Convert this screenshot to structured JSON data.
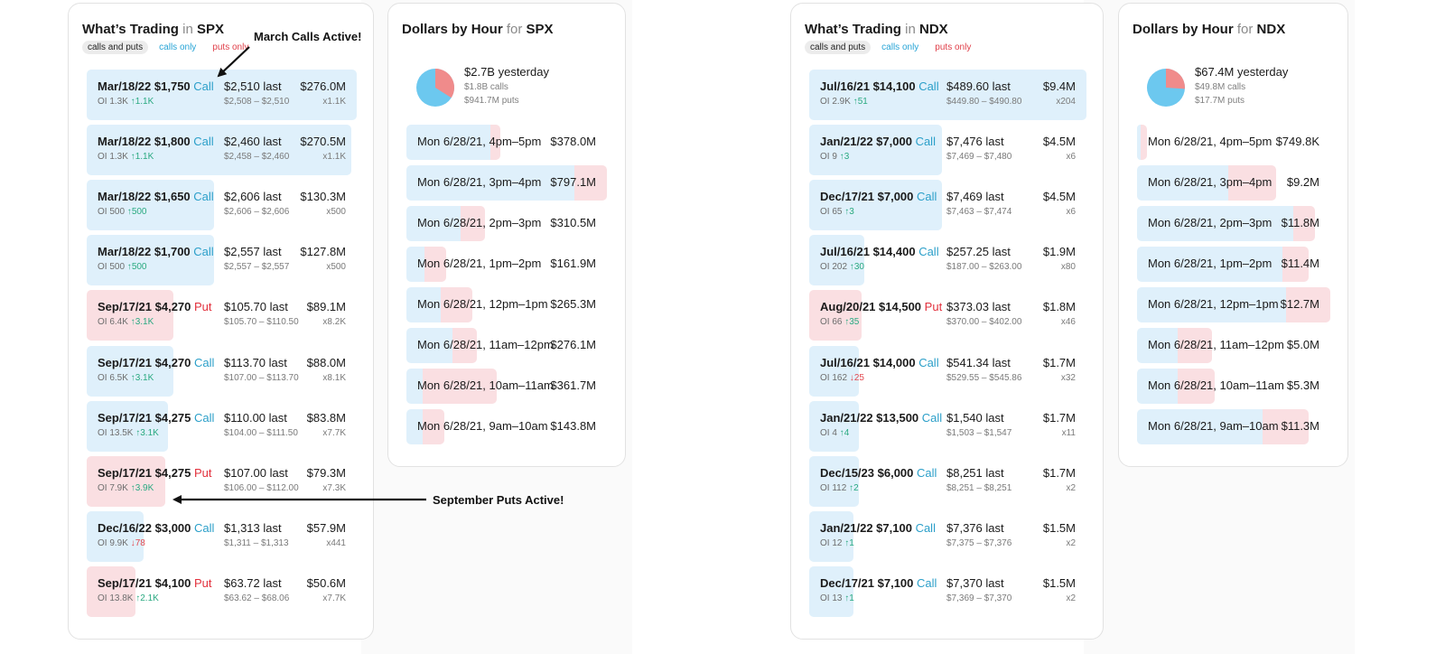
{
  "panels": [
    {
      "title": {
        "prefix": "What’s Trading",
        "joiner": "in",
        "symbol": "SPX"
      },
      "filters": {
        "all": "calls and puts",
        "calls": "calls only",
        "puts": "puts only"
      },
      "rows": [
        {
          "date": "Mar/18/22",
          "strike": "$1,750",
          "type": "Call",
          "oi": "OI 1.3K",
          "change": "1.1K",
          "dir": "up",
          "last": "$2,510",
          "range": "$2,508 – $2,510",
          "premium": "$276.0M",
          "mult": "x1.1K",
          "share": 1.0,
          "oi_share": 0.24
        },
        {
          "date": "Mar/18/22",
          "strike": "$1,800",
          "type": "Call",
          "oi": "OI 1.3K",
          "change": "1.1K",
          "dir": "up",
          "last": "$2,460",
          "range": "$2,458 – $2,460",
          "premium": "$270.5M",
          "mult": "x1.1K",
          "share": 0.98,
          "oi_share": 0.24
        },
        {
          "date": "Mar/18/22",
          "strike": "$1,650",
          "type": "Call",
          "oi": "OI 500",
          "change": "500",
          "dir": "up",
          "last": "$2,606",
          "range": "$2,606 – $2,606",
          "premium": "$130.3M",
          "mult": "x500",
          "share": 0.47,
          "oi_share": 0.18
        },
        {
          "date": "Mar/18/22",
          "strike": "$1,700",
          "type": "Call",
          "oi": "OI 500",
          "change": "500",
          "dir": "up",
          "last": "$2,557",
          "range": "$2,557 – $2,557",
          "premium": "$127.8M",
          "mult": "x500",
          "share": 0.47,
          "oi_share": 0.18
        },
        {
          "date": "Sep/17/21",
          "strike": "$4,270",
          "type": "Put",
          "oi": "OI 6.4K",
          "change": "3.1K",
          "dir": "up",
          "last": "$105.70 last",
          "range": "$105.70 – $110.50",
          "premium": "$89.1M",
          "mult": "x8.2K",
          "share": 0.32,
          "oi_share": 0.2
        },
        {
          "date": "Sep/17/21",
          "strike": "$4,270",
          "type": "Call",
          "oi": "OI 6.5K",
          "change": "3.1K",
          "dir": "up",
          "last": "$113.70 last",
          "range": "$107.00 – $113.70",
          "premium": "$88.0M",
          "mult": "x8.1K",
          "share": 0.32,
          "oi_share": 0.2
        },
        {
          "date": "Sep/17/21",
          "strike": "$4,275",
          "type": "Call",
          "oi": "OI 13.5K",
          "change": "3.1K",
          "dir": "up",
          "last": "$110.00 last",
          "range": "$104.00 – $111.50",
          "premium": "$83.8M",
          "mult": "x7.7K",
          "share": 0.3,
          "oi_share": 0.2
        },
        {
          "date": "Sep/17/21",
          "strike": "$4,275",
          "type": "Put",
          "oi": "OI 7.9K",
          "change": "3.9K",
          "dir": "up",
          "last": "$107.00 last",
          "range": "$106.00 – $112.00",
          "premium": "$79.3M",
          "mult": "x7.3K",
          "share": 0.29,
          "oi_share": 0.2
        },
        {
          "date": "Dec/16/22",
          "strike": "$3,000",
          "type": "Call",
          "oi": "OI 9.9K",
          "change": "78",
          "dir": "down",
          "last": "$1,313 last",
          "range": "$1,311 – $1,313",
          "premium": "$57.9M",
          "mult": "x441",
          "share": 0.21,
          "oi_share": 0.18
        },
        {
          "date": "Sep/17/21",
          "strike": "$4,100",
          "type": "Put",
          "oi": "OI 13.8K",
          "change": "2.1K",
          "dir": "up",
          "last": "$63.72 last",
          "range": "$63.62 – $68.06",
          "premium": "$50.6M",
          "mult": "x7.7K",
          "share": 0.18,
          "oi_share": 0.18
        }
      ]
    },
    {
      "title": {
        "prefix": "What’s Trading",
        "joiner": "in",
        "symbol": "NDX"
      },
      "filters": {
        "all": "calls and puts",
        "calls": "calls only",
        "puts": "puts only"
      },
      "rows": [
        {
          "date": "Jul/16/21",
          "strike": "$14,100",
          "type": "Call",
          "oi": "OI 2.9K",
          "change": "51",
          "dir": "up",
          "last": "$489.60 last",
          "range": "$449.80 – $490.80",
          "premium": "$9.4M",
          "mult": "x204",
          "share": 1.0,
          "oi_share": 0.16
        },
        {
          "date": "Jan/21/22",
          "strike": "$7,000",
          "type": "Call",
          "oi": "OI 9",
          "change": "3",
          "dir": "up",
          "last": "$7,476 last",
          "range": "$7,469 – $7,480",
          "premium": "$4.5M",
          "mult": "x6",
          "share": 0.48,
          "oi_share": 0.16
        },
        {
          "date": "Dec/17/21",
          "strike": "$7,000",
          "type": "Call",
          "oi": "OI 65",
          "change": "3",
          "dir": "up",
          "last": "$7,469 last",
          "range": "$7,463 – $7,474",
          "premium": "$4.5M",
          "mult": "x6",
          "share": 0.48,
          "oi_share": 0.16
        },
        {
          "date": "Jul/16/21",
          "strike": "$14,400",
          "type": "Call",
          "oi": "OI 202",
          "change": "30",
          "dir": "up",
          "last": "$257.25 last",
          "range": "$187.00 – $263.00",
          "premium": "$1.9M",
          "mult": "x80",
          "share": 0.2,
          "oi_share": 0.16
        },
        {
          "date": "Aug/20/21",
          "strike": "$14,500",
          "type": "Put",
          "oi": "OI 66",
          "change": "35",
          "dir": "up",
          "last": "$373.03 last",
          "range": "$370.00 – $402.00",
          "premium": "$1.8M",
          "mult": "x46",
          "share": 0.19,
          "oi_share": 0.16
        },
        {
          "date": "Jul/16/21",
          "strike": "$14,000",
          "type": "Call",
          "oi": "OI 162",
          "change": "25",
          "dir": "down",
          "last": "$541.34 last",
          "range": "$529.55 – $545.86",
          "premium": "$1.7M",
          "mult": "x32",
          "share": 0.18,
          "oi_share": 0.16
        },
        {
          "date": "Jan/21/22",
          "strike": "$13,500",
          "type": "Call",
          "oi": "OI 4",
          "change": "4",
          "dir": "up",
          "last": "$1,540 last",
          "range": "$1,503 – $1,547",
          "premium": "$1.7M",
          "mult": "x11",
          "share": 0.18,
          "oi_share": 0.16
        },
        {
          "date": "Dec/15/23",
          "strike": "$6,000",
          "type": "Call",
          "oi": "OI 112",
          "change": "2",
          "dir": "up",
          "last": "$8,251 last",
          "range": "$8,251 – $8,251",
          "premium": "$1.7M",
          "mult": "x2",
          "share": 0.18,
          "oi_share": 0.16
        },
        {
          "date": "Jan/21/22",
          "strike": "$7,100",
          "type": "Call",
          "oi": "OI 12",
          "change": "1",
          "dir": "up",
          "last": "$7,376 last",
          "range": "$7,375 – $7,376",
          "premium": "$1.5M",
          "mult": "x2",
          "share": 0.16,
          "oi_share": 0.16
        },
        {
          "date": "Dec/17/21",
          "strike": "$7,100",
          "type": "Call",
          "oi": "OI 13",
          "change": "1",
          "dir": "up",
          "last": "$7,370 last",
          "range": "$7,369 – $7,370",
          "premium": "$1.5M",
          "mult": "x2",
          "share": 0.16,
          "oi_share": 0.16
        }
      ]
    }
  ],
  "hourly": [
    {
      "title": {
        "prefix": "Dollars by Hour",
        "joiner": "for",
        "symbol": "SPX"
      },
      "summary": {
        "total": "$2.7B yesterday",
        "calls": "$1.8B calls",
        "puts": "$941.7M puts"
      },
      "pie": {
        "calls_fraction": 0.66
      },
      "rows": [
        {
          "label": "Mon 6/28/21, 4pm–5pm",
          "amount": "$378.0M",
          "calls_share": 0.42,
          "puts_share": 0.05
        },
        {
          "label": "Mon 6/28/21, 3pm–4pm",
          "amount": "$797.1M",
          "calls_share": 0.84,
          "puts_share": 0.16
        },
        {
          "label": "Mon 6/28/21, 2pm–3pm",
          "amount": "$310.5M",
          "calls_share": 0.27,
          "puts_share": 0.12
        },
        {
          "label": "Mon 6/28/21, 1pm–2pm",
          "amount": "$161.9M",
          "calls_share": 0.09,
          "puts_share": 0.11
        },
        {
          "label": "Mon 6/28/21, 12pm–1pm",
          "amount": "$265.3M",
          "calls_share": 0.17,
          "puts_share": 0.16
        },
        {
          "label": "Mon 6/28/21, 11am–12pm",
          "amount": "$276.1M",
          "calls_share": 0.23,
          "puts_share": 0.12
        },
        {
          "label": "Mon 6/28/21, 10am–11am",
          "amount": "$361.7M",
          "calls_share": 0.08,
          "puts_share": 0.37
        },
        {
          "label": "Mon 6/28/21, 9am–10am",
          "amount": "$143.8M",
          "calls_share": 0.08,
          "puts_share": 0.11
        }
      ]
    },
    {
      "title": {
        "prefix": "Dollars by Hour",
        "joiner": "for",
        "symbol": "NDX"
      },
      "summary": {
        "total": "$67.4M yesterday",
        "calls": "$49.8M calls",
        "puts": "$17.7M puts"
      },
      "pie": {
        "calls_fraction": 0.74
      },
      "rows": [
        {
          "label": "Mon 6/28/21, 4pm–5pm",
          "amount": "$749.8K",
          "calls_share": 0.02,
          "puts_share": 0.03
        },
        {
          "label": "Mon 6/28/21, 3pm–4pm",
          "amount": "$9.2M",
          "calls_share": 0.47,
          "puts_share": 0.25
        },
        {
          "label": "Mon 6/28/21, 2pm–3pm",
          "amount": "$11.8M",
          "calls_share": 0.81,
          "puts_share": 0.11
        },
        {
          "label": "Mon 6/28/21, 1pm–2pm",
          "amount": "$11.4M",
          "calls_share": 0.75,
          "puts_share": 0.14
        },
        {
          "label": "Mon 6/28/21, 12pm–1pm",
          "amount": "$12.7M",
          "calls_share": 0.77,
          "puts_share": 0.23
        },
        {
          "label": "Mon 6/28/21, 11am–12pm",
          "amount": "$5.0M",
          "calls_share": 0.21,
          "puts_share": 0.18
        },
        {
          "label": "Mon 6/28/21, 10am–11am",
          "amount": "$5.3M",
          "calls_share": 0.21,
          "puts_share": 0.19
        },
        {
          "label": "Mon 6/28/21, 9am–10am",
          "amount": "$11.3M",
          "calls_share": 0.65,
          "puts_share": 0.24
        }
      ]
    }
  ],
  "annotations": {
    "march": "March Calls Active!",
    "september": "September Puts Active!"
  },
  "colors": {
    "call": "#2b9fc9",
    "put": "#e2303c",
    "call_bar": "#dff0fb",
    "put_bar": "#fadfe2",
    "pie_call": "#6cc8ef",
    "pie_put": "#f08b8b"
  }
}
